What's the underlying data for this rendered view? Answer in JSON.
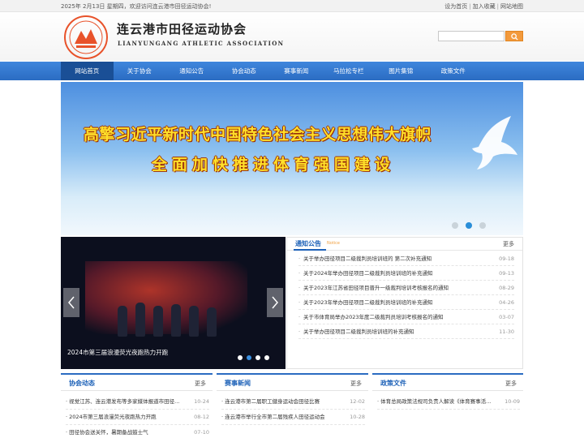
{
  "topbar": {
    "greeting": "2025年 2月13日 星期四，欢迎访问连云港市田径运动协会!",
    "set_home": "设为首页",
    "add_fav": "加入收藏",
    "sitemap": "网站地图",
    "separator": "|"
  },
  "header": {
    "title": "连云港市田径运动协会",
    "subtitle": "LIANYUNGANG ATHLETIC ASSOCIATION",
    "logo_color": "#e8522a",
    "search_placeholder": ""
  },
  "nav": {
    "items": [
      {
        "label": "网站首页",
        "active": true
      },
      {
        "label": "关于协会"
      },
      {
        "label": "通知公告"
      },
      {
        "label": "协会动态"
      },
      {
        "label": "赛事新闻"
      },
      {
        "label": "马拉松专栏"
      },
      {
        "label": "图片集锦"
      },
      {
        "label": "政策文件"
      }
    ]
  },
  "banner": {
    "line1": "高擎习近平新时代中国特色社会主义思想伟大旗帜",
    "line2": "全面加快推进体育强国建设",
    "dots": 3,
    "active_dot": 2
  },
  "photo_slider": {
    "caption": "2024市第三届浪漫荧光夜跑热力开跑",
    "prev_icon": "chevron-left-icon",
    "next_icon": "chevron-right-icon",
    "dots": 4,
    "active_dot": 2
  },
  "notice": {
    "title": "通知公告",
    "subtitle": "Notice",
    "more": "更多",
    "items": [
      {
        "title": "关于举办田径项目二级裁判员培训班的 第二次补充通知",
        "date": "09-18"
      },
      {
        "title": "关于2024年举办田径项目二级裁判员培训班的补充通知",
        "date": "09-13"
      },
      {
        "title": "关于2023年江苏省田径项目晋升一级裁判培训考核报名的通知",
        "date": "08-29"
      },
      {
        "title": "关于2023年举办田径项目二级裁判员培训班的补充通知",
        "date": "04-26"
      },
      {
        "title": "关于市体育局举办2023年度二级裁判员培训考核报名的通知",
        "date": "03-07"
      },
      {
        "title": "关于举办田径项目二级裁判员培训班的补充通知",
        "date": "11-30"
      }
    ]
  },
  "panels": [
    {
      "title": "协会动态",
      "more": "更多",
      "items": [
        {
          "title": "· 视觉江苏、连云港发布等多家媒体报道市田径...",
          "date": "10-24"
        },
        {
          "title": "· 2024市第三届浪漫荧光夜跑热力开跑",
          "date": "08-12"
        },
        {
          "title": "· 田径协会送关怀，暑期备战鼓士气",
          "date": "07-10"
        }
      ]
    },
    {
      "title": "赛事新闻",
      "more": "更多",
      "items": [
        {
          "title": "· 连云港市第二届职工健身运动会田径比赛",
          "date": "12-02"
        },
        {
          "title": "· 连云港市举行全市第二届残疾人田径运动会",
          "date": "10-28"
        }
      ]
    },
    {
      "title": "政策文件",
      "more": "更多",
      "items": [
        {
          "title": "· 体育总局政策法规司负责人解读《体育赛事活...",
          "date": "10-09"
        }
      ]
    }
  ],
  "colors": {
    "nav_blue": "#2b6cc2",
    "nav_active": "#1a4f96",
    "heading_blue": "#1e62b8",
    "search_orange": "#f39a3c",
    "banner_text": "#ffe02a"
  }
}
